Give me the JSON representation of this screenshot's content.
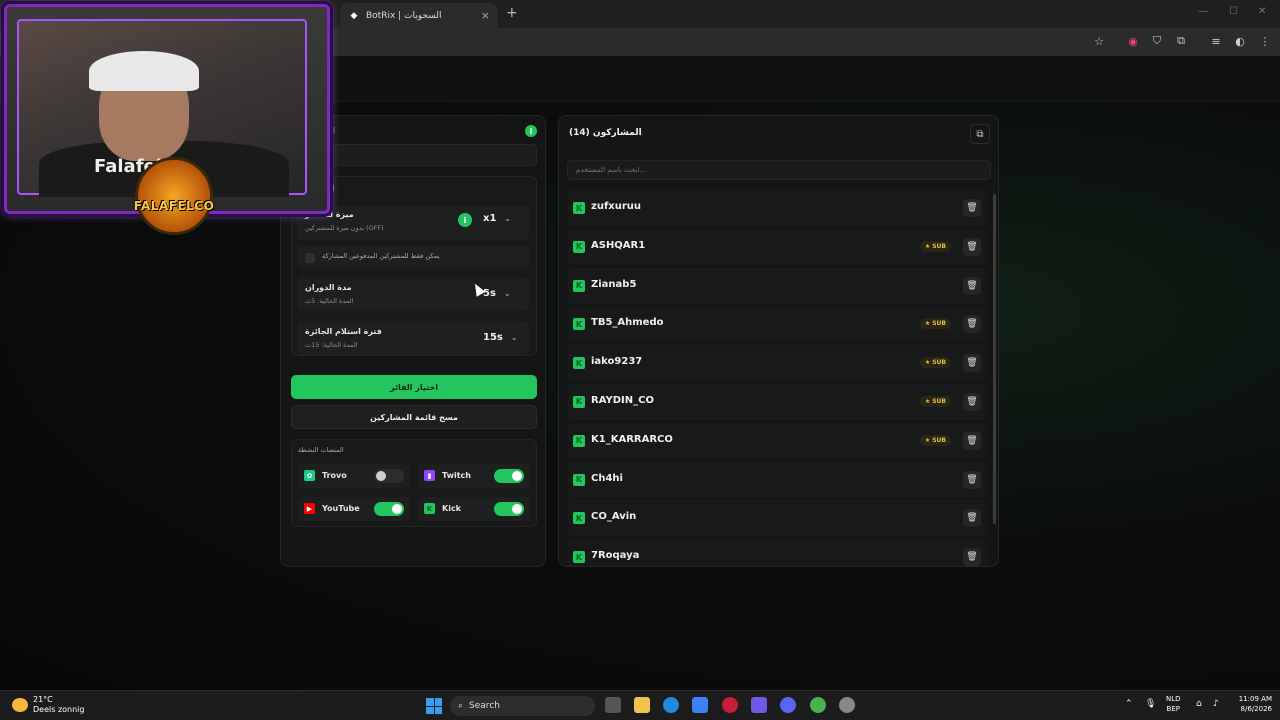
{
  "browser": {
    "tab_title": "BotRix | السحوبات",
    "tab_close": "×",
    "new_tab": "+",
    "window_controls": [
      "—",
      "☐",
      "✕"
    ]
  },
  "left_panel": {
    "title": "ال",
    "info_glyph": "i",
    "settings_label": "إعدادات",
    "multiplier": {
      "title": "ميزة للمشتر",
      "subtitle": "بدون ميزة للمشتركين (OFF)",
      "value": "x1",
      "info_glyph": "i"
    },
    "paid_only_label": "يمكن فقط للمشتركين المدفوعين المشاركة",
    "spin_duration": {
      "title": "مدة الدوران",
      "subtitle": "المدة الحالية: 5ث",
      "value": "5s"
    },
    "claim_period": {
      "title": "فترة استلام الجائزة",
      "subtitle": "المدة الحالية: 15ث",
      "value": "15s"
    },
    "pick_winner_label": "اختيار الفائز",
    "clear_list_label": "مسح قائمة المشاركين",
    "platforms_title": "المنصات النشطة",
    "platforms": [
      {
        "name": "Trovo",
        "icon": "trovo-icon",
        "color": "#1ecc8a",
        "enabled": false
      },
      {
        "name": "Twitch",
        "icon": "twitch-icon",
        "color": "#9146ff",
        "enabled": true
      },
      {
        "name": "YouTube",
        "icon": "youtube-icon",
        "color": "#ff0000",
        "enabled": true
      },
      {
        "name": "Kick",
        "icon": "kick-icon",
        "color": "#53fc18",
        "enabled": true
      }
    ]
  },
  "right_panel": {
    "title": "المشاركون (14)",
    "search_placeholder": "ابحث باسم المستخدم...",
    "sub_label": "SUB",
    "participants": [
      {
        "name": "zufxuruu",
        "sub": false
      },
      {
        "name": "ASHQAR1",
        "sub": true
      },
      {
        "name": "Zianab5",
        "sub": false
      },
      {
        "name": "TB5_Ahmedo",
        "sub": true
      },
      {
        "name": "iako9237",
        "sub": true
      },
      {
        "name": "RAYDIN_CO",
        "sub": true
      },
      {
        "name": "K1_KARRARCO",
        "sub": true
      },
      {
        "name": "Ch4hi",
        "sub": false
      },
      {
        "name": "CO_Avin",
        "sub": false
      },
      {
        "name": "7Roqaya",
        "sub": false
      }
    ]
  },
  "webcam": {
    "shirt_text": "Falafelco",
    "logo_text": "FALAFELCO"
  },
  "taskbar": {
    "weather_temp": "21°C",
    "weather_desc": "Deels zonnig",
    "search_label": "Search",
    "lang_top": "NLD",
    "lang_bottom": "BEP",
    "time": "11:09 AM",
    "date": "8/6/2026"
  },
  "colors": {
    "accent_green": "#22c55e",
    "webcam_frame": "#7b2cbf",
    "sub_gold": "#e2c044"
  }
}
